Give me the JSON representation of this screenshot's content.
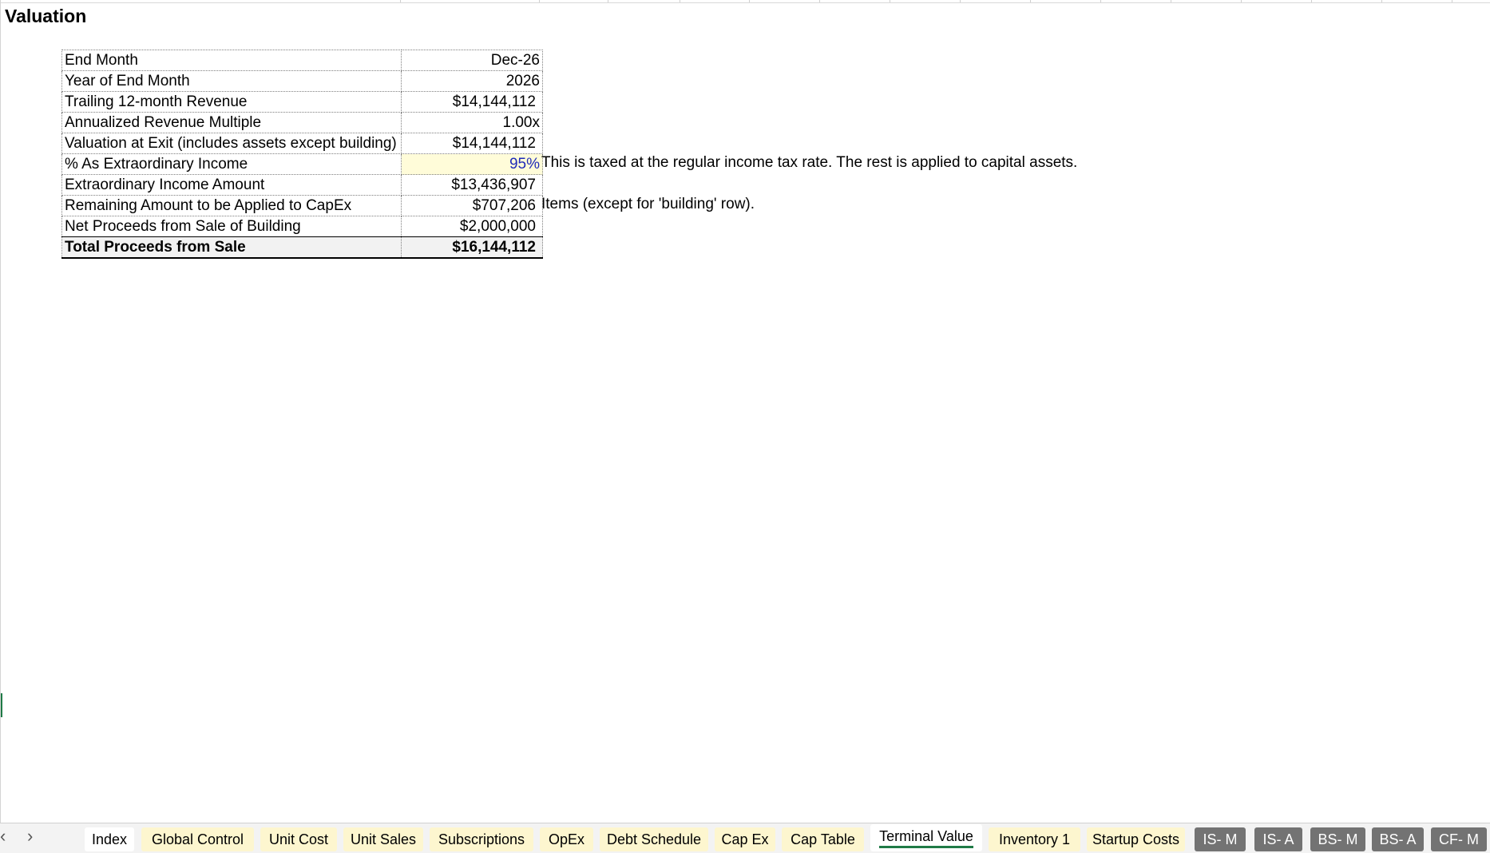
{
  "sheet": {
    "title": "Valuation"
  },
  "valuation": {
    "rows": [
      {
        "label": "End Month",
        "value": "Dec-26"
      },
      {
        "label": "Year of End Month",
        "value": "2026"
      },
      {
        "label": "Trailing 12-month Revenue",
        "value": "$14,144,112"
      },
      {
        "label": "Annualized Revenue Multiple",
        "value": "1.00x"
      },
      {
        "label": "Valuation at Exit (includes assets except building)",
        "value": "$14,144,112"
      },
      {
        "label": "% As Extraordinary Income",
        "value": "95%"
      },
      {
        "label": "Extraordinary Income Amount",
        "value": "$13,436,907"
      },
      {
        "label": "Remaining Amount to be Applied to CapEx",
        "value": "$707,206"
      },
      {
        "label": "Net Proceeds from Sale of Building",
        "value": "$2,000,000"
      }
    ],
    "total": {
      "label": "Total Proceeds from Sale",
      "value": "$16,144,112"
    },
    "notes": {
      "extraordinary": "This is taxed at the regular income tax rate. The rest is applied to capital assets.",
      "capex": "Items (except for 'building' row)."
    }
  },
  "nav": {
    "prev": "‹",
    "next": "›"
  },
  "tabs": [
    {
      "label": "Index"
    },
    {
      "label": "Global Control"
    },
    {
      "label": "Unit Cost"
    },
    {
      "label": "Unit Sales"
    },
    {
      "label": "Subscriptions"
    },
    {
      "label": "OpEx"
    },
    {
      "label": "Debt Schedule"
    },
    {
      "label": "Cap Ex"
    },
    {
      "label": "Cap Table"
    },
    {
      "label": "Terminal Value"
    },
    {
      "label": "Inventory 1"
    },
    {
      "label": "Startup Costs"
    },
    {
      "label": "IS- M"
    },
    {
      "label": "IS- A"
    },
    {
      "label": "BS- M"
    },
    {
      "label": "BS- A"
    },
    {
      "label": "CF- M"
    }
  ],
  "colors": {
    "input_fill": "#fffcd9",
    "input_text": "#1f2bb8",
    "tab_yellow": "#fdf6cf",
    "tab_gray": "#737373",
    "active_underline": "#1f7a46"
  }
}
